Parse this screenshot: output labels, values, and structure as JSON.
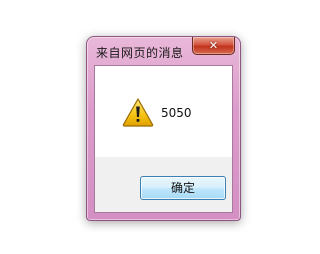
{
  "dialog": {
    "title": "来自网页的消息",
    "close_icon": "close-icon",
    "close_glyph": "✕",
    "message": "5050",
    "icon": "warning-icon",
    "ok_label": "确定",
    "colors": {
      "frame": "#dc9ccb",
      "close_button": "#c0331c",
      "ok_button_border": "#3c7fb1",
      "button_area": "#f0f0f0",
      "warning_yellow": "#f5c211"
    }
  }
}
